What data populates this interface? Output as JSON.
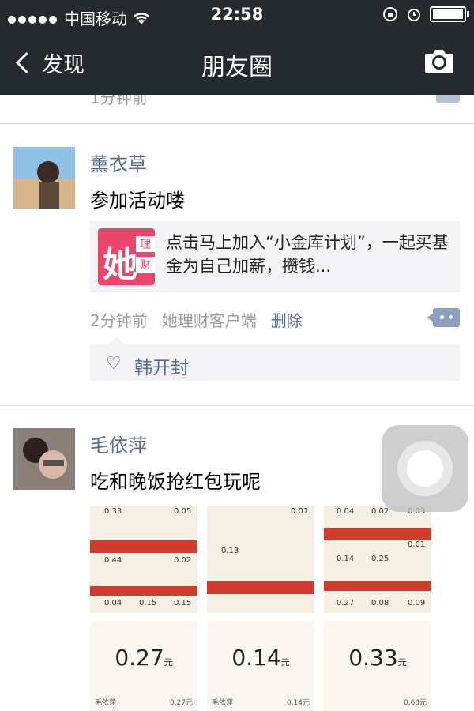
{
  "status_bar": {
    "carrier": "中国移动",
    "time": "22:58"
  },
  "nav": {
    "back_label": "发现",
    "title": "朋友圈",
    "camera_icon": "camera-icon"
  },
  "feed": {
    "prev_post_time": "1分钟前",
    "posts": [
      {
        "author": "薰衣草",
        "text": "参加活动喽",
        "share": {
          "logo_text": "她",
          "logo_side_top": "理",
          "logo_side_bottom": "财",
          "description": "点击马上加入“小金库计划”，一起买基金为自己加薪，攒钱..."
        },
        "time": "2分钟前",
        "source": "她理财客户端",
        "delete_label": "删除",
        "likes": [
          "韩开封"
        ]
      },
      {
        "author": "毛依萍",
        "text": "吃和晚饭抢红包玩呢",
        "photo_grid": {
          "top_values": [
            [
              "0.33",
              "0.05",
              "0.44",
              "0.02",
              "0.04",
              "0.15",
              "0.15"
            ],
            [
              "0.01",
              "0.13"
            ],
            [
              "0.04",
              "0.02",
              "0.03",
              "0.01",
              "0.14",
              "0.25",
              "0.27",
              "0.08",
              "0.09"
            ]
          ],
          "cards": [
            {
              "amount": "0.27",
              "unit": "元",
              "user": "毛依萍",
              "value": "0.27元"
            },
            {
              "amount": "0.14",
              "unit": "元",
              "user": "毛依萍",
              "value": "0.14元"
            },
            {
              "amount": "0.33",
              "unit": "元",
              "user": "",
              "value": "0.68元"
            }
          ]
        }
      }
    ]
  },
  "colors": {
    "nav_bg": "#252a2f",
    "link": "#576b95",
    "logo": "#e8466b",
    "envelope_red": "#d23a2e"
  }
}
